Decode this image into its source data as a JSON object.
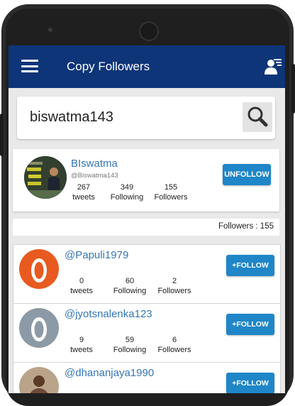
{
  "appbar": {
    "title": "Copy Followers",
    "menu_icon": "hamburger-menu-icon",
    "action_icon": "followers-list-icon",
    "color": "#0e3578"
  },
  "search": {
    "value": "biswatma143",
    "icon": "search-icon"
  },
  "profile": {
    "name": "BIswatma",
    "handle": "@Biswatma143",
    "tweets_count": "267",
    "tweets_label": "tweets",
    "following_count": "349",
    "following_label": "Following",
    "followers_count": "155",
    "followers_label": "Followers",
    "unfollow_label": "UNFOLLOW"
  },
  "followers_count_label": "Followers : 155",
  "accent_color": "#1f86c8",
  "users": [
    {
      "name": "@Papuli1979",
      "tweets": "0",
      "following": "60",
      "followers": "2",
      "tweets_label": "tweets",
      "following_label": "Following",
      "followers_label": "Followers",
      "follow_label": "+FOLLOW",
      "avatar": "orange-egg-avatar"
    },
    {
      "name": "@jyotsnalenka123",
      "tweets": "9",
      "following": "59",
      "followers": "6",
      "tweets_label": "tweets",
      "following_label": "Following",
      "followers_label": "Followers",
      "follow_label": "+FOLLOW",
      "avatar": "gray-egg-avatar"
    },
    {
      "name": "@dhananjaya1990",
      "follow_label": "+FOLLOW",
      "avatar": "photo-avatar"
    }
  ]
}
